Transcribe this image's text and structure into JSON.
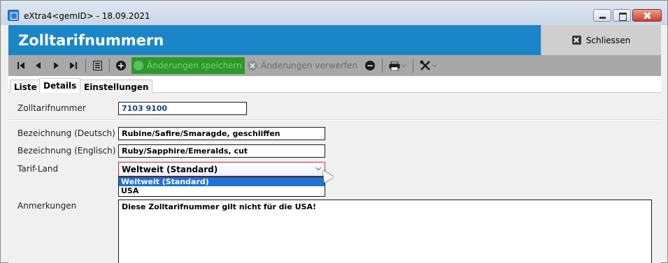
{
  "window": {
    "title": "eXtra4<gemID>  -  18.09.2021"
  },
  "header": {
    "title": "Zolltarifnummern",
    "close_label": "Schliessen"
  },
  "toolbar": {
    "save_label": "Änderungen speichern",
    "discard_label": "Änderungen verwerfen"
  },
  "tabs": [
    {
      "label": "Liste",
      "active": false
    },
    {
      "label": "Details",
      "active": true
    },
    {
      "label": "Einstellungen",
      "active": false
    }
  ],
  "form": {
    "tariff_number_label": "Zolltarifnummer",
    "tariff_number_value": "7103 9100",
    "desc_de_label": "Bezeichnung (Deutsch)",
    "desc_de_value": "Rubine/Safire/Smaragde, geschliffen",
    "desc_en_label": "Bezeichnung (Englisch)",
    "desc_en_value": "Ruby/Sapphire/Emeralds, cut",
    "country_label": "Tarif-Land",
    "country_value": "Weltweit (Standard)",
    "country_options": [
      "Weltweit (Standard)",
      "USA"
    ],
    "notes_label": "Anmerkungen",
    "notes_value": "Diese Zolltarifnummer gilt nicht für die USA!"
  },
  "colors": {
    "header_blue": "#1b86c7",
    "save_green": "#2a9a2a",
    "selection_blue": "#1c74d8",
    "focus_red": "#c0283a"
  }
}
